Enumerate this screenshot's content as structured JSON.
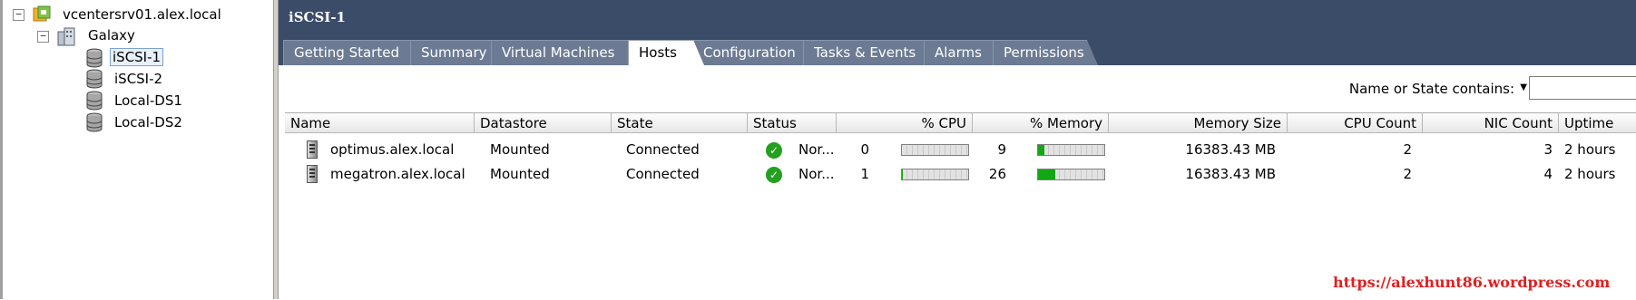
{
  "tree": {
    "root": "vcentersrv01.alex.local",
    "datacenter": "Galaxy",
    "datastores": [
      "iSCSI-1",
      "iSCSI-2",
      "Local-DS1",
      "Local-DS2"
    ],
    "selected": "iSCSI-1"
  },
  "panel": {
    "title": "iSCSI-1",
    "tabs": [
      "Getting Started",
      "Summary",
      "Virtual Machines",
      "Hosts",
      "Configuration",
      "Tasks & Events",
      "Alarms",
      "Permissions"
    ],
    "active_tab": "Hosts"
  },
  "filter": {
    "label": "Name or State contains:",
    "value": ""
  },
  "table": {
    "columns": [
      "Name",
      "Datastore",
      "State",
      "Status",
      "% CPU",
      "% Memory",
      "Memory Size",
      "CPU Count",
      "NIC Count",
      "Uptime"
    ],
    "rows": [
      {
        "name": "optimus.alex.local",
        "datastore": "Mounted",
        "state": "Connected",
        "status": "Nor...",
        "cpu": "0",
        "cpu_level": 0,
        "memory": "9",
        "memory_level": 9,
        "memory_size": "16383.43 MB",
        "cpu_count": "2",
        "nic_count": "3",
        "uptime": "2 hours"
      },
      {
        "name": "megatron.alex.local",
        "datastore": "Mounted",
        "state": "Connected",
        "status": "Nor...",
        "cpu": "1",
        "cpu_level": 1,
        "memory": "26",
        "memory_level": 26,
        "memory_size": "16383.43 MB",
        "cpu_count": "2",
        "nic_count": "4",
        "uptime": "2 hours"
      }
    ]
  },
  "watermark": "https://alexhunt86.wordpress.com",
  "colors": {
    "header_bg": "#3b4c68",
    "tab_bg": "#6c7b93",
    "bar_fill": "#14a614",
    "status_ok": "#24a01f",
    "watermark": "#e02020"
  }
}
